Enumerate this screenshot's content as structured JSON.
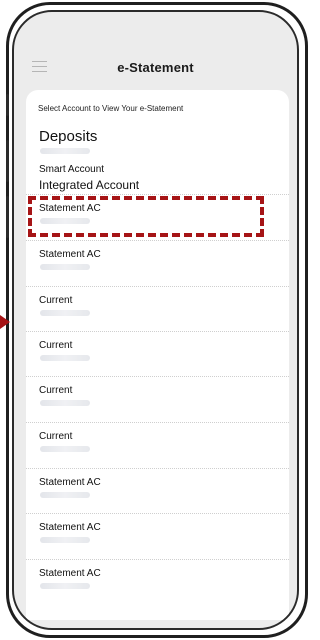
{
  "header": {
    "title": "e-Statement"
  },
  "instruction": "Select Account to View Your e-Statement",
  "section": {
    "title": "Deposits",
    "account_type": "Smart Account",
    "account_name": "Integrated Account"
  },
  "accounts": [
    {
      "label": "Statement AC"
    },
    {
      "label": "Statement AC"
    },
    {
      "label": "Current"
    },
    {
      "label": "Current"
    },
    {
      "label": "Current"
    },
    {
      "label": "Current"
    },
    {
      "label": "Statement AC"
    },
    {
      "label": "Statement AC"
    },
    {
      "label": "Statement AC"
    }
  ],
  "colors": {
    "highlight": "#a61416",
    "background": "#ececec",
    "card": "#ffffff"
  },
  "icons": [
    "hamburger-menu-icon",
    "arrow-pointer-icon"
  ]
}
